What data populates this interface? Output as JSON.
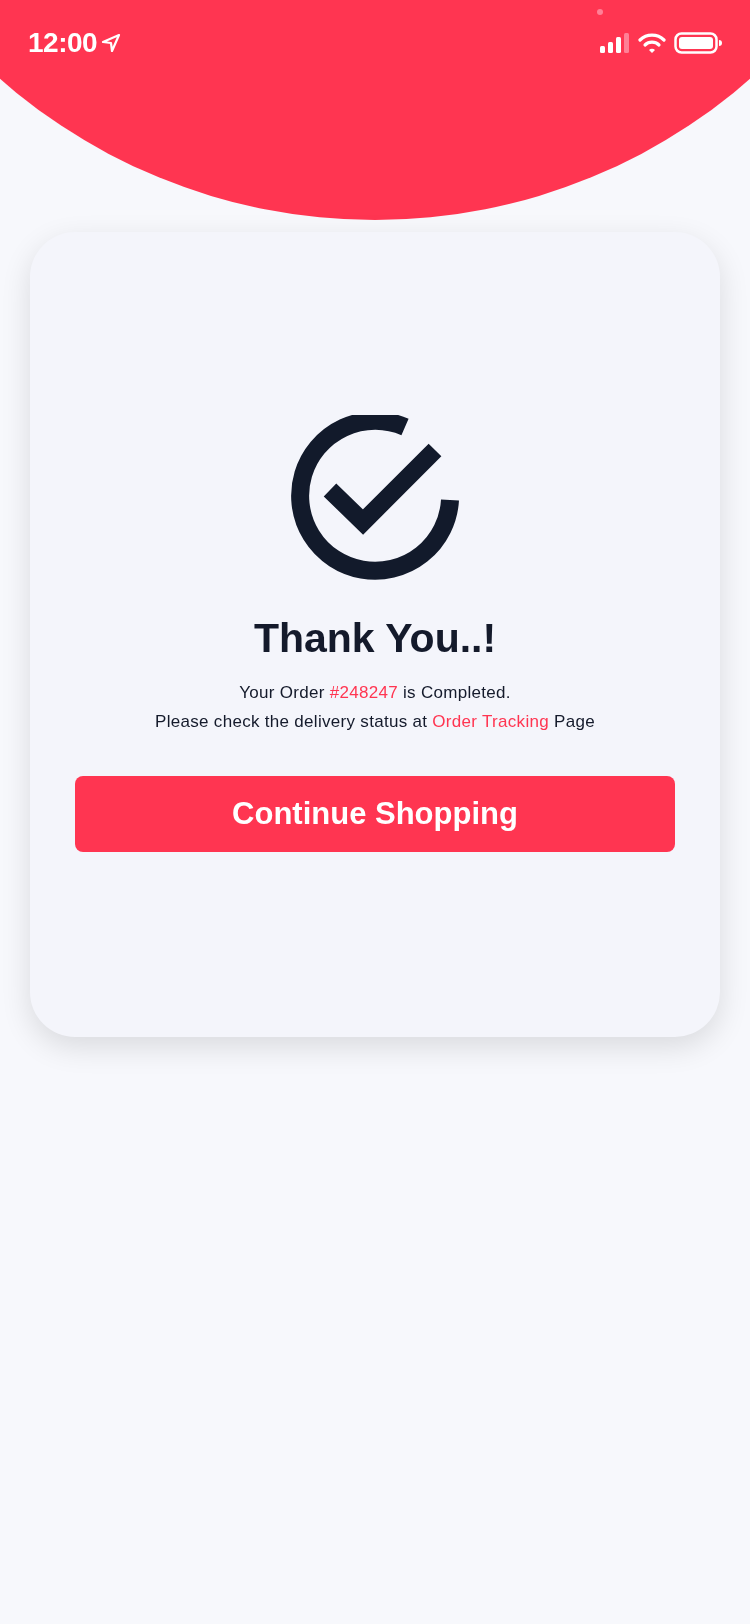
{
  "status_bar": {
    "time": "12:00"
  },
  "confirmation": {
    "title": "Thank You..!",
    "order_line": {
      "before": "Your Order ",
      "order_number": "#248247",
      "after": " is Completed."
    },
    "tracking_line": {
      "before": "Please check the delivery status at ",
      "link": "Order Tracking",
      "after": " Page"
    },
    "button": "Continue Shopping"
  }
}
